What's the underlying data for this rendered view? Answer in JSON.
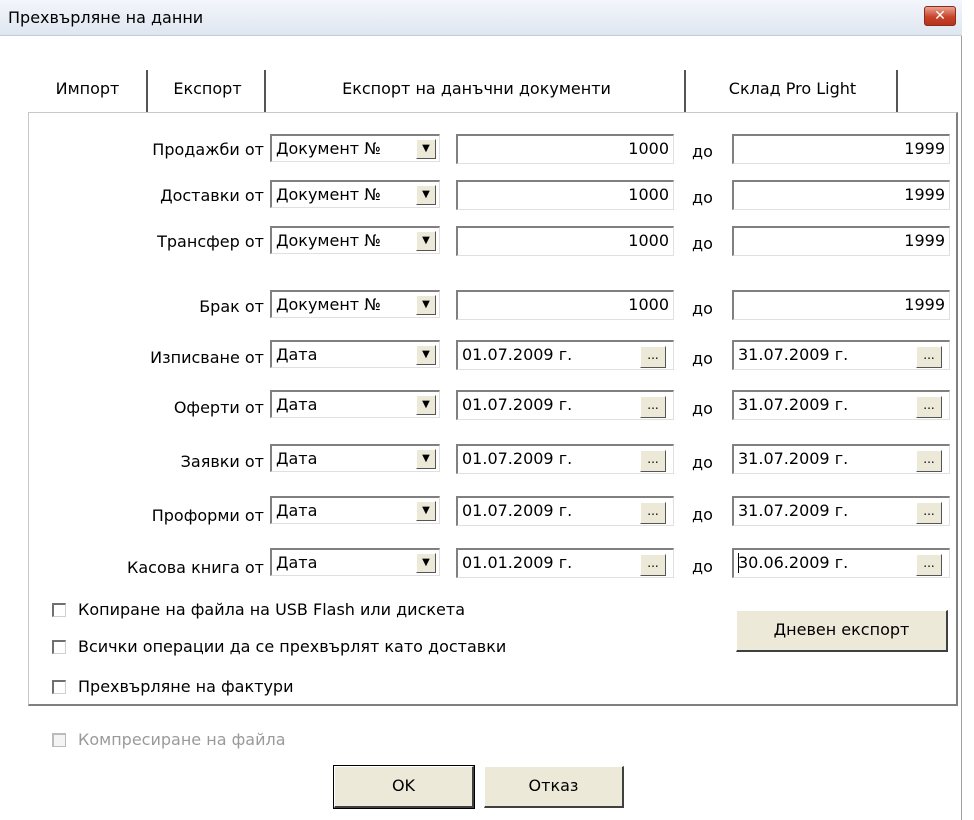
{
  "window": {
    "title": "Прехвърляне на данни"
  },
  "tabs": [
    {
      "label": "Импорт"
    },
    {
      "label": "Експорт"
    },
    {
      "label": "Експорт на данъчни документи"
    },
    {
      "label": "Склад Pro Light"
    }
  ],
  "rows": [
    {
      "label": "Продажби от",
      "type": "Документ №",
      "from": "1000",
      "to": "1999"
    },
    {
      "label": "Доставки от",
      "type": "Документ №",
      "from": "1000",
      "to": "1999"
    },
    {
      "label": "Трансфер от",
      "type": "Документ №",
      "from": "1000",
      "to": "1999"
    },
    {
      "label": "Брак от",
      "type": "Документ №",
      "from": "1000",
      "to": "1999"
    },
    {
      "label": "Изписване от",
      "type": "Дата",
      "from": "01.07.2009 г.",
      "to": "31.07.2009 г."
    },
    {
      "label": "Оферти от",
      "type": "Дата",
      "from": "01.07.2009 г.",
      "to": "31.07.2009 г."
    },
    {
      "label": "Заявки от",
      "type": "Дата",
      "from": "01.07.2009 г.",
      "to": "31.07.2009 г."
    },
    {
      "label": "Проформи от",
      "type": "Дата",
      "from": "01.07.2009 г.",
      "to": "31.07.2009 г."
    },
    {
      "label": "Касова книга от",
      "type": "Дата",
      "from": "01.01.2009 г.",
      "to": "30.06.2009 г."
    }
  ],
  "to_label": "до",
  "ellipsis": "...",
  "close_glyph": "✕",
  "arrow_glyph": "▼",
  "checkboxes": [
    {
      "label": "Копиране на файла на USB Flash или дискета",
      "checked": false
    },
    {
      "label": "Всички операции да се прехвърлят като доставки",
      "checked": false
    },
    {
      "label": "Прехвърляне на фактури",
      "checked": false
    }
  ],
  "compress": {
    "label": "Компресиране на файла",
    "checked": false,
    "disabled": true
  },
  "buttons": {
    "daily_export": "Дневен експорт",
    "ok": "OK",
    "cancel": "Отказ"
  },
  "colors": {
    "close_button": "#c7442a",
    "button_face": "#ece9d8",
    "disabled_text": "#9a9a9a"
  }
}
